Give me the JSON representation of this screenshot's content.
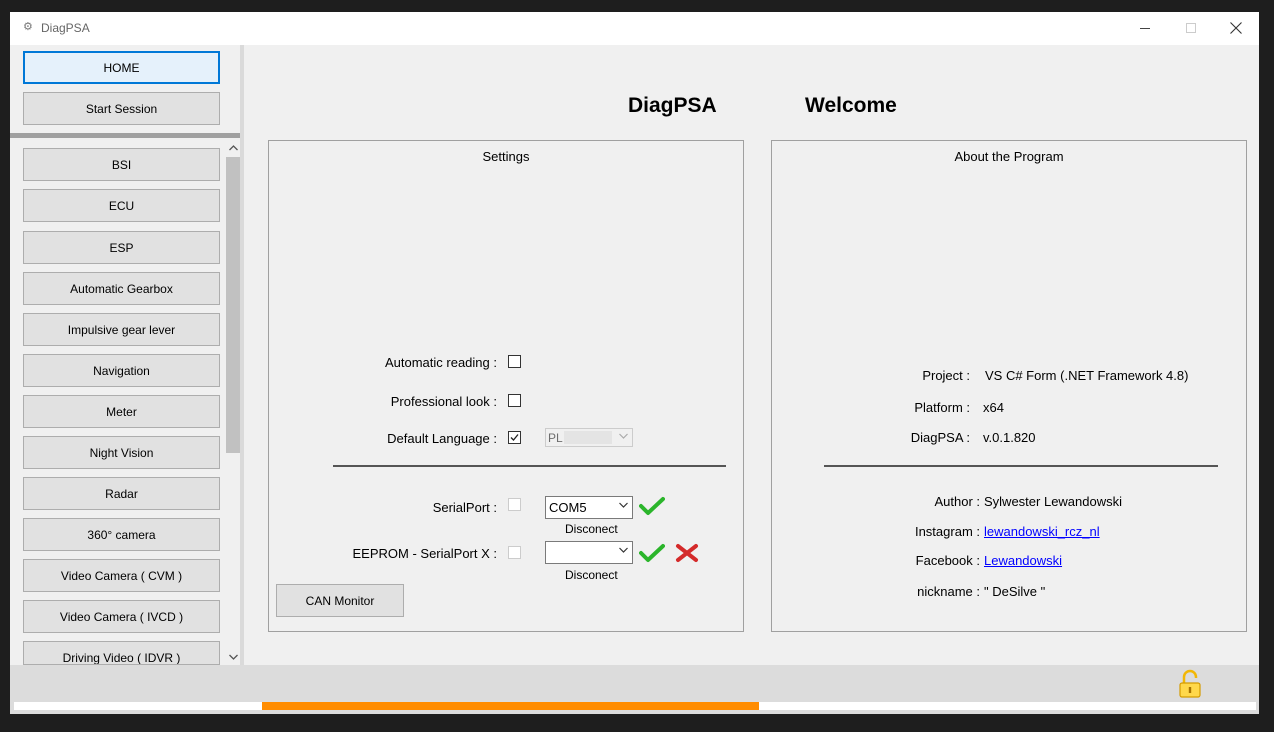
{
  "window": {
    "title": "DiagPSA",
    "icon": "app-icon"
  },
  "sidebar": {
    "home_label": "HOME",
    "start_label": "Start Session",
    "items": [
      {
        "label": "BSI"
      },
      {
        "label": "ECU"
      },
      {
        "label": "ESP"
      },
      {
        "label": "Automatic Gearbox"
      },
      {
        "label": "Impulsive gear lever"
      },
      {
        "label": "Navigation"
      },
      {
        "label": "Meter"
      },
      {
        "label": "Night Vision"
      },
      {
        "label": "Radar"
      },
      {
        "label": "360° camera"
      },
      {
        "label": "Video Camera ( CVM )"
      },
      {
        "label": "Video Camera ( IVCD )"
      },
      {
        "label": "Driving Video ( IDVR )"
      }
    ]
  },
  "header": {
    "app_name": "DiagPSA",
    "welcome": "Welcome"
  },
  "settings": {
    "title": "Settings",
    "automatic_reading_label": "Automatic reading :",
    "automatic_reading_checked": false,
    "professional_look_label": "Professional look :",
    "professional_look_checked": false,
    "default_language_label": "Default Language :",
    "default_language_checked": true,
    "language_value": "PL",
    "serialport_label": "SerialPort :",
    "serialport_value": "COM5",
    "serialport_status": "Disconect",
    "eeprom_label": "EEPROM - SerialPort X :",
    "eeprom_value": "",
    "eeprom_status": "Disconect",
    "can_monitor_label": "CAN Monitor"
  },
  "about": {
    "title": "About the Program",
    "project_label": "Project :",
    "project_value": "VS C# Form (.NET Framework 4.8)",
    "platform_label": "Platform :",
    "platform_value": "x64",
    "version_label": "DiagPSA :",
    "version_value": "v.0.1.820",
    "author_label": "Author :",
    "author_value": "Sylwester Lewandowski",
    "instagram_label": "Instagram :",
    "instagram_value": "lewandowski_rcz_nl",
    "facebook_label": "Facebook :",
    "facebook_value": "Lewandowski",
    "nickname_label": "nickname :",
    "nickname_value": "\" DeSilve \""
  },
  "status": {
    "progress_percent": 40,
    "lock_icon": "padlock-open-icon"
  },
  "colors": {
    "accent": "#0078d7",
    "progress": "#ff8c00",
    "link": "#0000ff"
  }
}
